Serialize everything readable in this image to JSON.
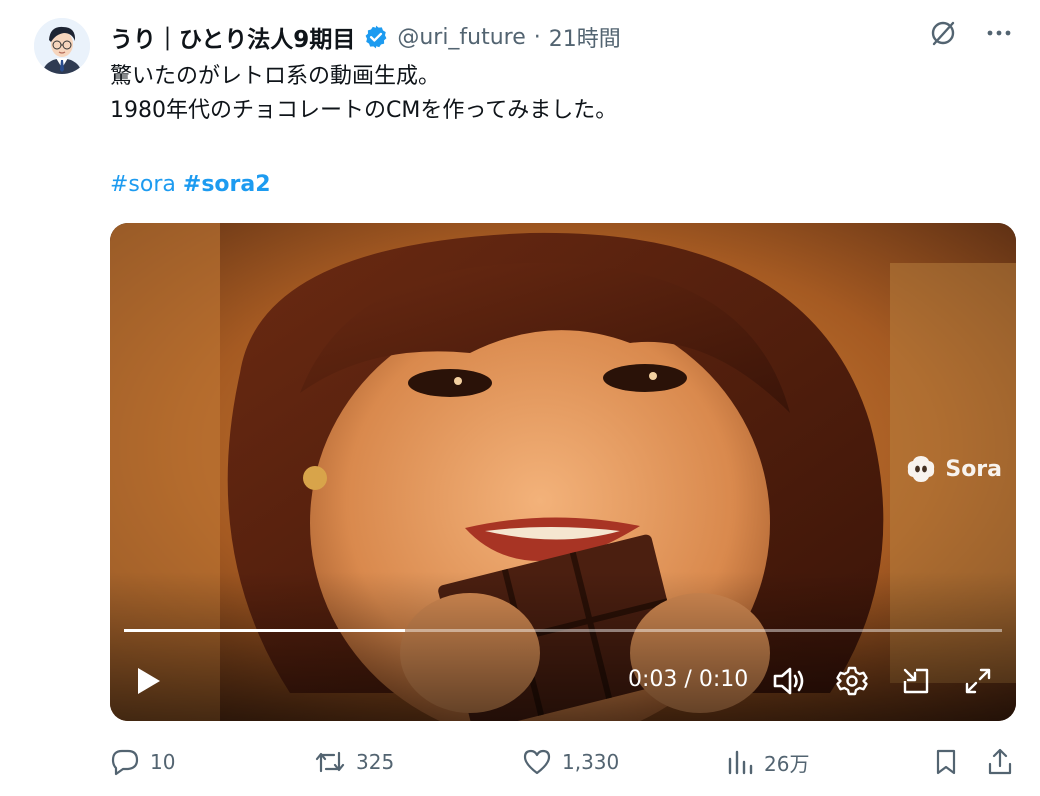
{
  "tweet": {
    "author_name": "うり｜ひとり法人9期目",
    "handle": "@uri_future",
    "separator": "·",
    "time": "21時間",
    "lines": [
      "驚いたのがレトロ系の動画生成。",
      "1980年代のチョコレートのCMを作ってみました。"
    ],
    "hashtags": [
      "#sora",
      "#sora2"
    ]
  },
  "video": {
    "watermark": "Sora",
    "current_time": "0:03",
    "time_separator": "/",
    "duration": "0:10",
    "progress_percent": 32
  },
  "actions": {
    "replies": "10",
    "reposts": "325",
    "likes": "1,330",
    "views": "26万"
  },
  "colors": {
    "accent": "#1d9bf0",
    "text": "#0f1419",
    "secondary": "#536471"
  }
}
